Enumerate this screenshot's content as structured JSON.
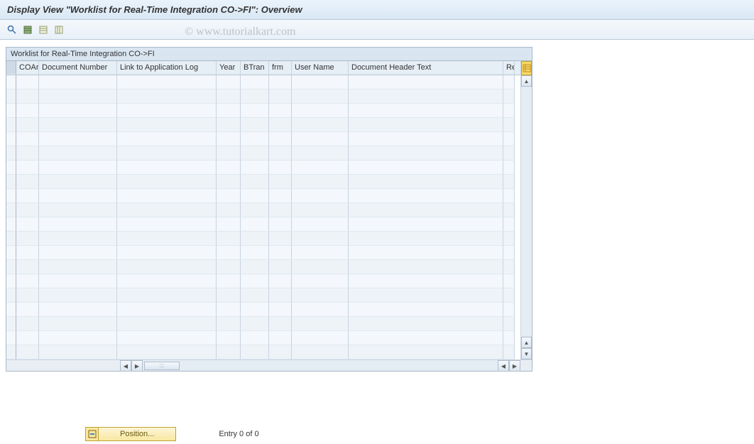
{
  "title": "Display View \"Worklist for Real-Time Integration CO->FI\": Overview",
  "toolbar": {
    "icons": [
      "details-icon",
      "table-select-icon",
      "table-deselect-icon",
      "table-columns-icon"
    ]
  },
  "table": {
    "title": "Worklist for Real-Time Integration CO->FI",
    "columns": [
      "COAr",
      "Document Number",
      "Link to Application Log",
      "Year",
      "BTran",
      "frm",
      "User Name",
      "Document Header Text",
      "Re"
    ],
    "row_count": 20
  },
  "footer": {
    "position_label": "Position...",
    "entry_text": "Entry 0 of 0"
  },
  "watermark": "© www.tutorialkart.com"
}
